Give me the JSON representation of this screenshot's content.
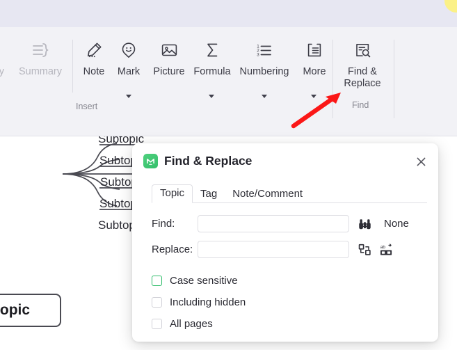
{
  "window": {
    "top_band_color": "#e7e7f2",
    "ribbon_bg_color": "#f2f2f6",
    "accent_green": "#2fbd6a",
    "annotation_color": "#fb1717"
  },
  "ribbon": {
    "group_insert_label": "Insert",
    "group_find_label": "Find",
    "items": [
      {
        "id": "partial-left",
        "label": "ry",
        "icon": "truncated-icon",
        "disabled": true,
        "has_caret": false
      },
      {
        "id": "summary",
        "label": "Summary",
        "icon": "summary-icon",
        "disabled": true,
        "has_caret": false
      },
      {
        "id": "note",
        "label": "Note",
        "icon": "note-pencil-icon",
        "disabled": false,
        "has_caret": false
      },
      {
        "id": "mark",
        "label": "Mark",
        "icon": "mark-smiley-pin-icon",
        "disabled": false,
        "has_caret": true
      },
      {
        "id": "picture",
        "label": "Picture",
        "icon": "picture-image-icon",
        "disabled": false,
        "has_caret": false
      },
      {
        "id": "formula",
        "label": "Formula",
        "icon": "formula-sigma-icon",
        "disabled": false,
        "has_caret": true
      },
      {
        "id": "numbering",
        "label": "Numbering",
        "icon": "numbering-list-icon",
        "disabled": false,
        "has_caret": true
      },
      {
        "id": "more",
        "label": "More",
        "icon": "more-panel-icon",
        "disabled": false,
        "has_caret": true
      },
      {
        "id": "find-replace",
        "label": "Find & Replace",
        "icon": "find-replace-magnifier-icon",
        "disabled": false,
        "has_caret": false
      }
    ]
  },
  "dialog": {
    "title": "Find & Replace",
    "logo_icon": "xmind-logo-icon",
    "close_icon": "close-icon",
    "tabs": [
      {
        "label": "Topic",
        "active": true
      },
      {
        "label": "Tag",
        "active": false
      },
      {
        "label": "Note/Comment",
        "active": false
      }
    ],
    "find": {
      "label": "Find:",
      "value": "",
      "placeholder": "",
      "search_icon": "binoculars-icon",
      "match_count": "None"
    },
    "replace": {
      "label": "Replace:",
      "value": "",
      "placeholder": "",
      "replace_one_icon": "replace-one-icon",
      "replace_all_icon": "replace-all-icon"
    },
    "options": [
      {
        "label": "Case sensitive",
        "checked": false,
        "highlighted": true
      },
      {
        "label": "Including hidden",
        "checked": false,
        "highlighted": false
      },
      {
        "label": "All pages",
        "checked": false,
        "highlighted": false
      }
    ]
  },
  "canvas": {
    "central_topic": "topic",
    "subtopics": [
      {
        "label": "Subtopic"
      },
      {
        "label": "Subtopic"
      },
      {
        "label": "Subtopic"
      },
      {
        "label": "Subtopic"
      },
      {
        "label": "Subtopic"
      }
    ]
  }
}
